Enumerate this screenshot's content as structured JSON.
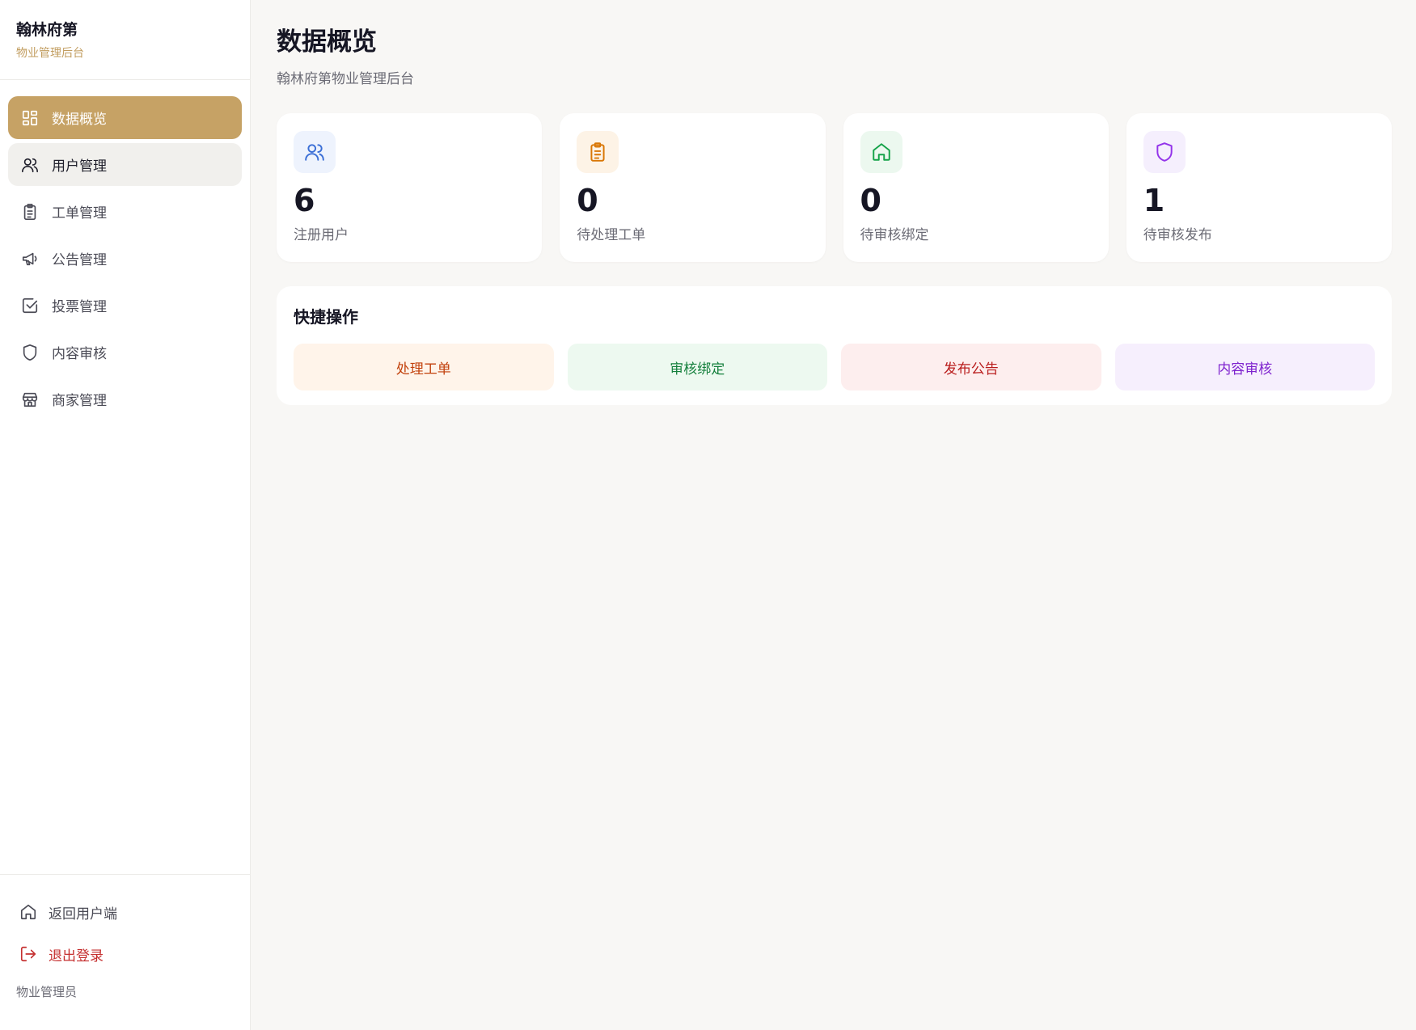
{
  "brand": {
    "name": "翰林府第",
    "subtitle": "物业管理后台"
  },
  "sidebar": {
    "items": [
      {
        "label": "数据概览",
        "icon": "dashboard-icon",
        "state": "active"
      },
      {
        "label": "用户管理",
        "icon": "users-icon",
        "state": "hover"
      },
      {
        "label": "工单管理",
        "icon": "clipboard-icon",
        "state": "normal"
      },
      {
        "label": "公告管理",
        "icon": "megaphone-icon",
        "state": "normal"
      },
      {
        "label": "投票管理",
        "icon": "checkbox-icon",
        "state": "normal"
      },
      {
        "label": "内容审核",
        "icon": "shield-icon",
        "state": "normal"
      },
      {
        "label": "商家管理",
        "icon": "store-icon",
        "state": "normal"
      }
    ],
    "bottom": {
      "back_label": "返回用户端",
      "logout_label": "退出登录",
      "role": "物业管理员"
    }
  },
  "header": {
    "title": "数据概览",
    "subtitle": "翰林府第物业管理后台"
  },
  "stats": [
    {
      "value": "6",
      "label": "注册用户",
      "icon": "users-icon",
      "color": "#3b6fd6",
      "bg": "#eef3fd"
    },
    {
      "value": "0",
      "label": "待处理工单",
      "icon": "clipboard-icon",
      "color": "#d97706",
      "bg": "#fdf3e6"
    },
    {
      "value": "0",
      "label": "待审核绑定",
      "icon": "home-icon",
      "color": "#16a34a",
      "bg": "#ecf8ef"
    },
    {
      "value": "1",
      "label": "待审核发布",
      "icon": "shield-icon",
      "color": "#9333ea",
      "bg": "#f5effd"
    }
  ],
  "quick": {
    "title": "快捷操作",
    "buttons": [
      {
        "label": "处理工单",
        "color": "#c2410c",
        "bg": "#fff4ea"
      },
      {
        "label": "审核绑定",
        "color": "#15803d",
        "bg": "#edf9f0"
      },
      {
        "label": "发布公告",
        "color": "#b91c1c",
        "bg": "#fdeeee"
      },
      {
        "label": "内容审核",
        "color": "#7e22ce",
        "bg": "#f6effd"
      }
    ]
  },
  "colors": {
    "accent": "#c6a265",
    "background": "#f8f7f5"
  }
}
